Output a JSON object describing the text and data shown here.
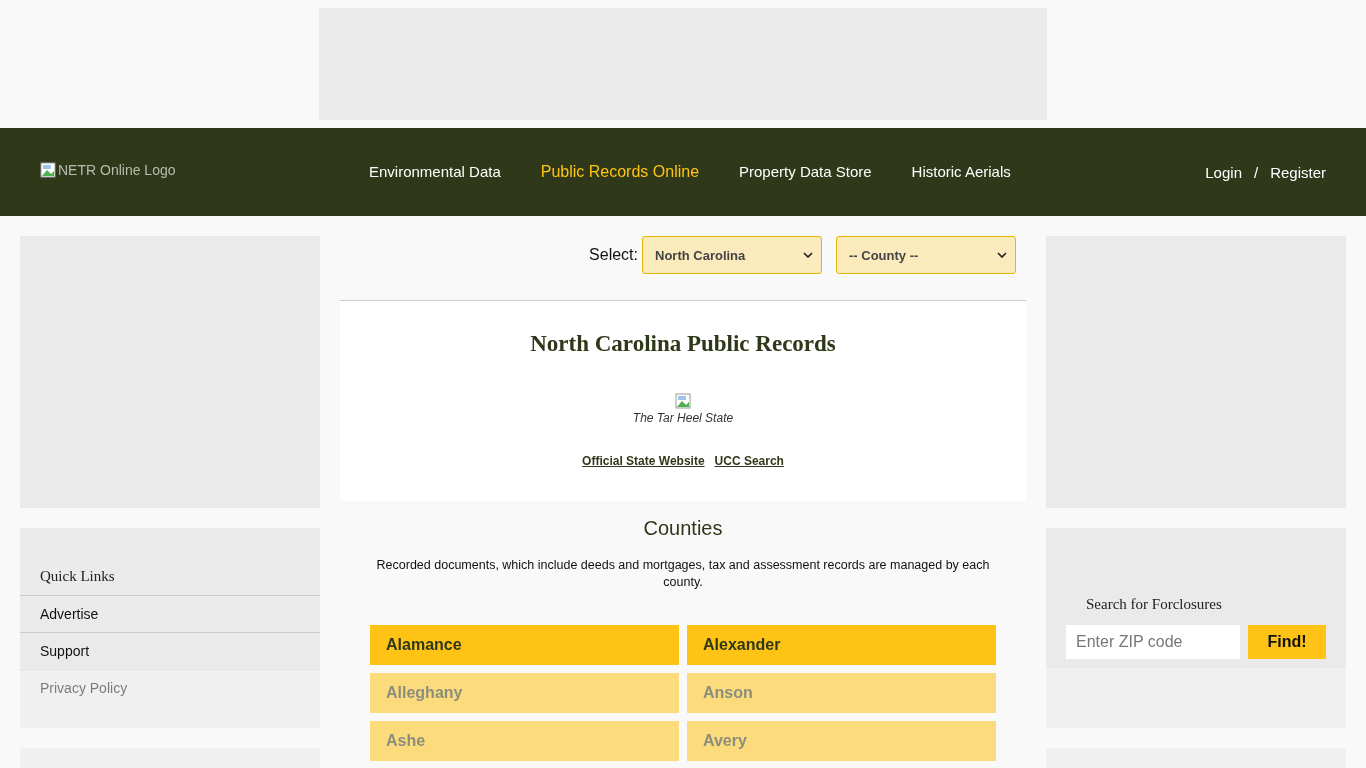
{
  "header": {
    "logo_alt": "NETR Online Logo",
    "nav": [
      {
        "label": "Environmental Data",
        "selected": false
      },
      {
        "label": "Public Records Online",
        "selected": true
      },
      {
        "label": "Property Data Store",
        "selected": false
      },
      {
        "label": "Historic Aerials",
        "selected": false
      }
    ],
    "login": "Login",
    "separator": "/",
    "register": "Register"
  },
  "select": {
    "label": "Select:",
    "state": "North Carolina",
    "county_placeholder": "-- County --"
  },
  "state_panel": {
    "title": "North Carolina Public Records",
    "caption": "The Tar Heel State",
    "links": [
      "Official State Website",
      "UCC Search"
    ]
  },
  "counties": {
    "heading": "Counties",
    "intro": "Recorded documents, which include deeds and mortgages, tax and assessment records are managed by each county.",
    "items": [
      "Alamance",
      "Alexander",
      "Alleghany",
      "Anson",
      "Ashe",
      "Avery"
    ]
  },
  "quick_links": {
    "title": "Quick Links",
    "items": [
      "Advertise",
      "Support",
      "Privacy Policy"
    ]
  },
  "foreclosures": {
    "title": "Search for Forclosures",
    "placeholder": "Enter ZIP code",
    "button": "Find!"
  }
}
